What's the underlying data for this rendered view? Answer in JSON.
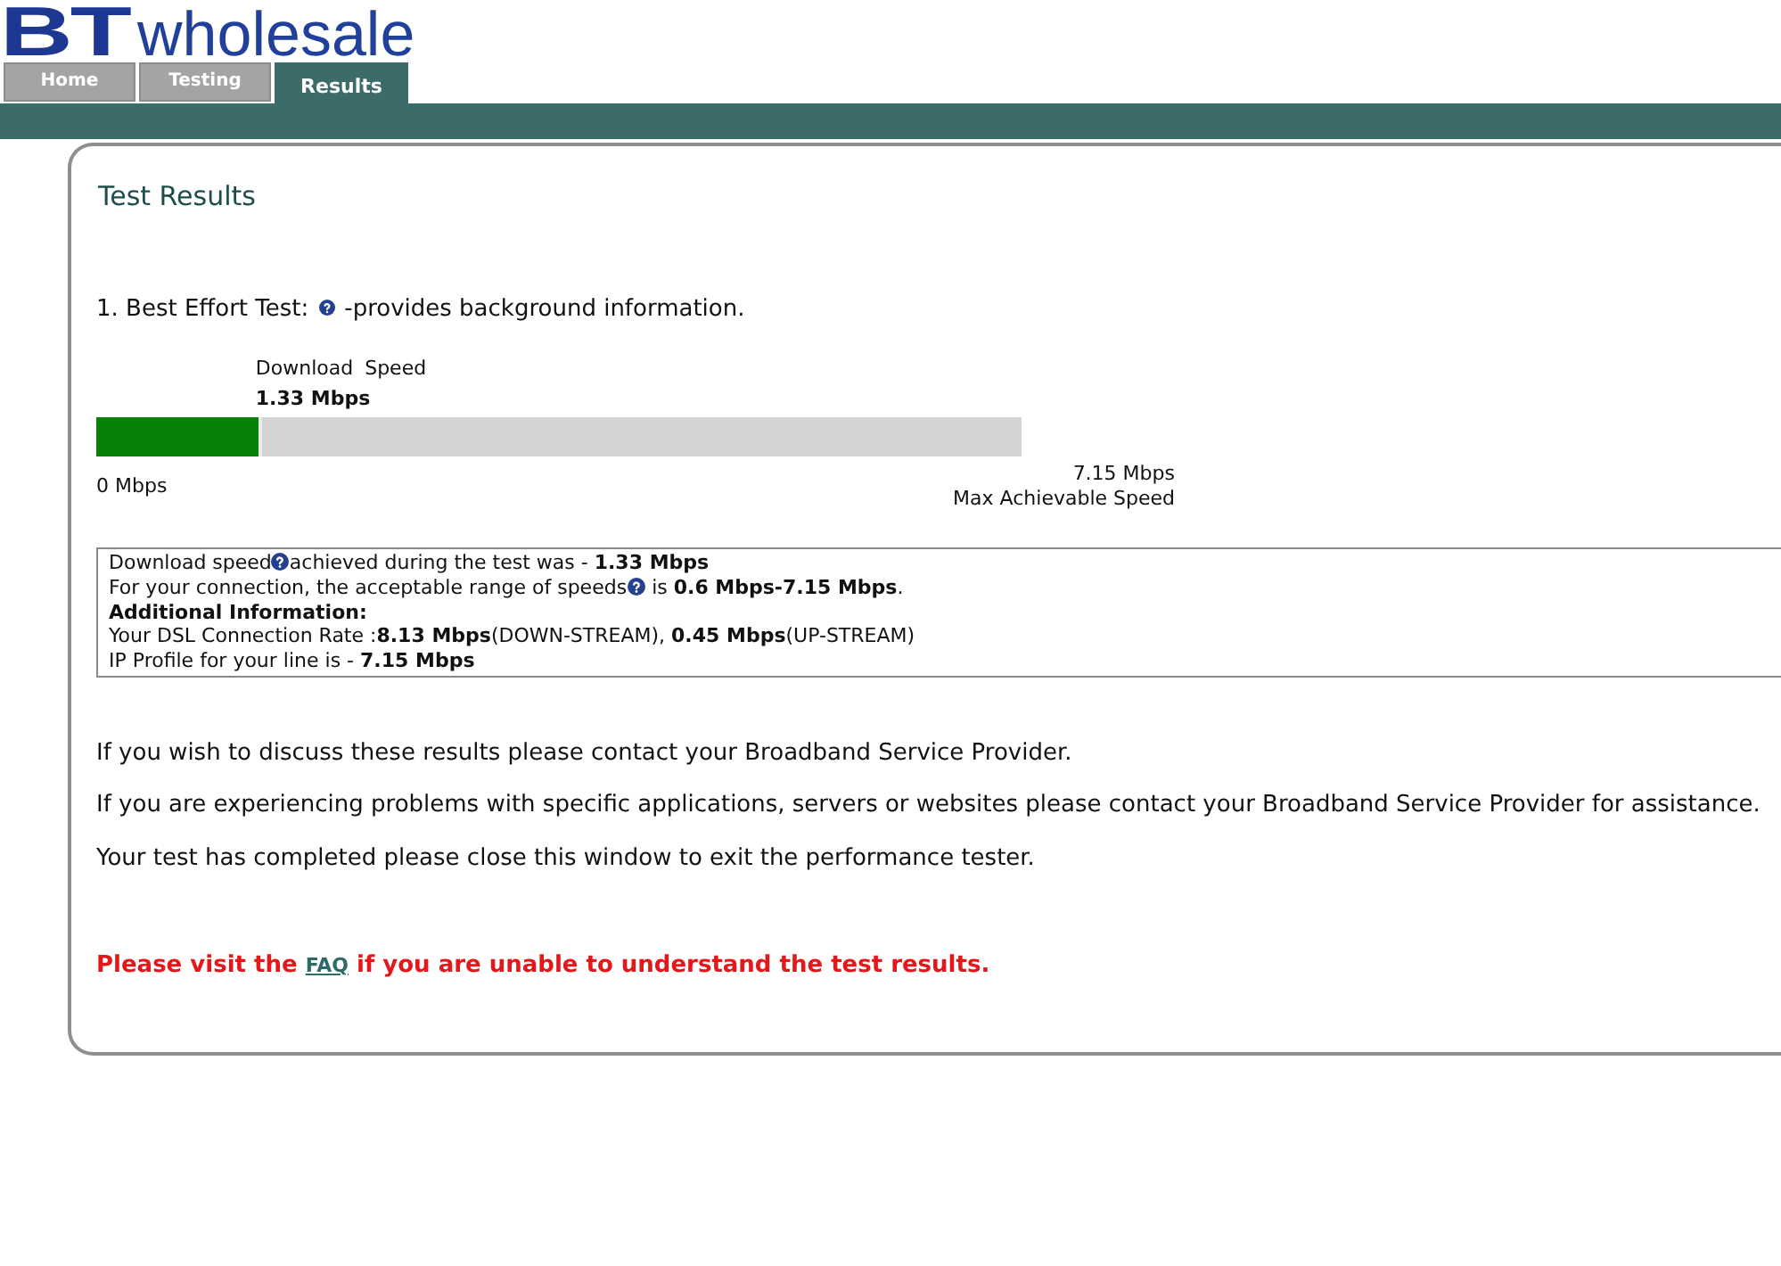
{
  "logo": {
    "letters": "BT",
    "wordmark": "wholesale"
  },
  "tabs": [
    {
      "label": "Home",
      "selected": false
    },
    {
      "label": "Testing",
      "selected": false
    },
    {
      "label": "Results",
      "selected": true
    }
  ],
  "panel": {
    "title": "Test Results",
    "test_heading": {
      "before": "1. Best Effort Test:",
      "after": "-provides background information."
    },
    "speed_meter": {
      "label": "Download Speed",
      "reading": "1.33 Mbps",
      "level": 0.18,
      "min_label": "0 Mbps",
      "max_label": "7.15 Mbps",
      "max_caption": "Max Achievable Speed"
    },
    "info_box": {
      "lines": [
        {
          "kind": "help",
          "before": "Download speed",
          "after": "achieved during the test was - **1.33 Mbps**"
        },
        {
          "kind": "help",
          "before": "For your connection, the acceptable range of speeds",
          "after": "is **0.6 Mbps-7.15 Mbps**."
        },
        {
          "kind": "heading",
          "text": "Additional Information:"
        },
        {
          "kind": "text",
          "text": "Your DSL Connection Rate :**8.13 Mbps**(DOWN-STREAM), **0.45 Mbps**(UP-STREAM)"
        },
        {
          "kind": "text",
          "text": "IP Profile for your line is - **7.15 Mbps**"
        }
      ]
    },
    "paragraphs": [
      "If you wish to discuss these results please contact your Broadband Service Provider.",
      "If you are experiencing problems with specific applications, servers or websites please contact your Broadband Service Provider for assistance.",
      "Your test has completed please close this window to exit the performance tester."
    ],
    "faq_notice": {
      "before": "Please visit the",
      "link": "FAQ",
      "after": "if you are unable to understand the test results."
    }
  }
}
